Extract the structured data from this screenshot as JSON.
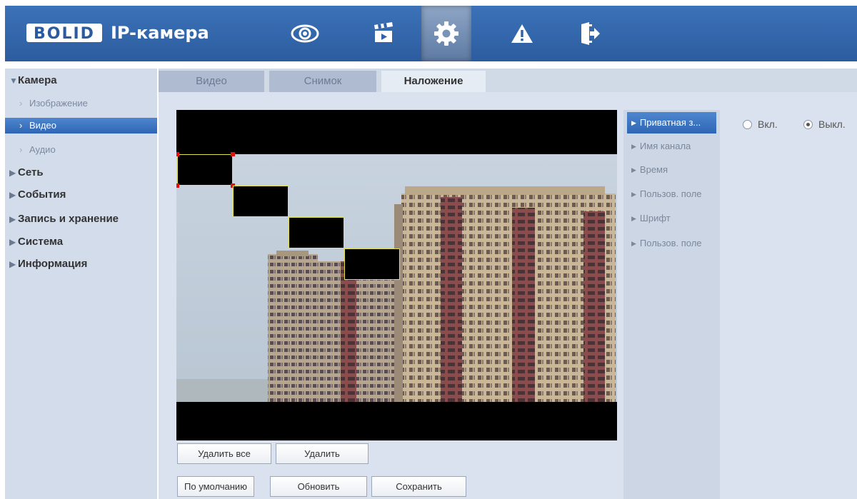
{
  "header": {
    "logo_brand": "BOLID",
    "logo_title": "IP-камера",
    "nav_icons": [
      "eye-icon",
      "clapperboard-icon",
      "gear-icon",
      "warning-icon",
      "logout-icon"
    ],
    "active_nav": "gear-icon"
  },
  "sidebar": {
    "sections": [
      {
        "label": "Камера",
        "expanded": true
      },
      {
        "label": "Сеть"
      },
      {
        "label": "События"
      },
      {
        "label": "Запись и хранение"
      },
      {
        "label": "Система"
      },
      {
        "label": "Информация"
      }
    ],
    "camera_items": [
      "Изображение",
      "Видео",
      "Аудио"
    ],
    "active_item": "Видео"
  },
  "tabs": [
    "Видео",
    "Снимок",
    "Наложение"
  ],
  "active_tab": "Наложение",
  "buttons": {
    "delete_all": "Удалить все",
    "delete": "Удалить",
    "default": "По умолчанию",
    "refresh": "Обновить",
    "save": "Сохранить"
  },
  "overlay_menu": [
    "Приватная з...",
    "Имя канала",
    "Время",
    "Пользов. поле",
    "Шрифт",
    "Пользов. поле"
  ],
  "active_overlay": "Приватная з...",
  "privacy": {
    "on_label": "Вкл.",
    "off_label": "Выкл.",
    "selected": "Выкл."
  },
  "colors": {
    "header": "#2f63a8",
    "active": "#3a72c2",
    "mask_border": "#e4e04a",
    "handle": "#e01010"
  }
}
